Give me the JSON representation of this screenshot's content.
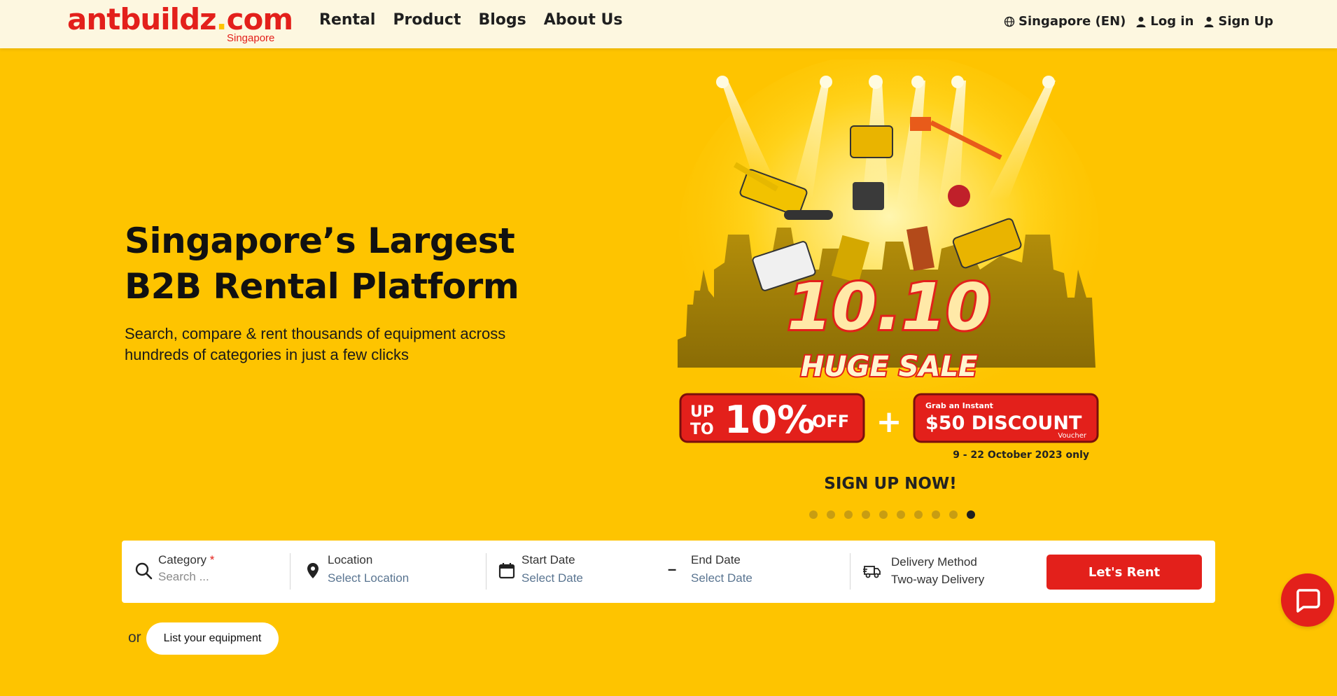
{
  "header": {
    "logo": {
      "main": "antbuildz",
      "dot": ".",
      "tld": "com",
      "sub": "Singapore"
    },
    "nav": [
      "Rental",
      "Product",
      "Blogs",
      "About Us"
    ],
    "region": "Singapore (EN)",
    "login": "Log in",
    "signup": "Sign Up"
  },
  "hero": {
    "title_line1": "Singapore’s Largest",
    "title_line2": "B2B Rental Platform",
    "subtitle": "Search, compare & rent thousands of equipment across hundreds of categories in just a few clicks"
  },
  "banner": {
    "headline": "10.10",
    "subhead": "HUGE SALE",
    "up_to": "UP",
    "to": "TO",
    "percent": "10%",
    "off": "OFF",
    "plus": "+",
    "grab": "Grab an Instant",
    "discount": "$50 DISCOUNT",
    "voucher": "Voucher",
    "dates": "9 - 22 October 2023 only",
    "cta": "SIGN UP NOW!",
    "slide_count": 10,
    "active_slide": 10
  },
  "search": {
    "category": {
      "label": "Category",
      "required": "*",
      "placeholder": "Search ..."
    },
    "location": {
      "label": "Location",
      "value": "Select Location"
    },
    "start_date": {
      "label": "Start Date",
      "value": "Select Date"
    },
    "separator": "–",
    "end_date": {
      "label": "End Date",
      "value": "Select Date"
    },
    "delivery": {
      "label": "Delivery Method",
      "value": "Two-way Delivery"
    },
    "submit": "Let's Rent"
  },
  "list": {
    "or": "or",
    "button": "List your equipment"
  },
  "colors": {
    "brand_red": "#e3201b",
    "brand_yellow": "#fec400",
    "header_bg": "#fdf7e0"
  }
}
